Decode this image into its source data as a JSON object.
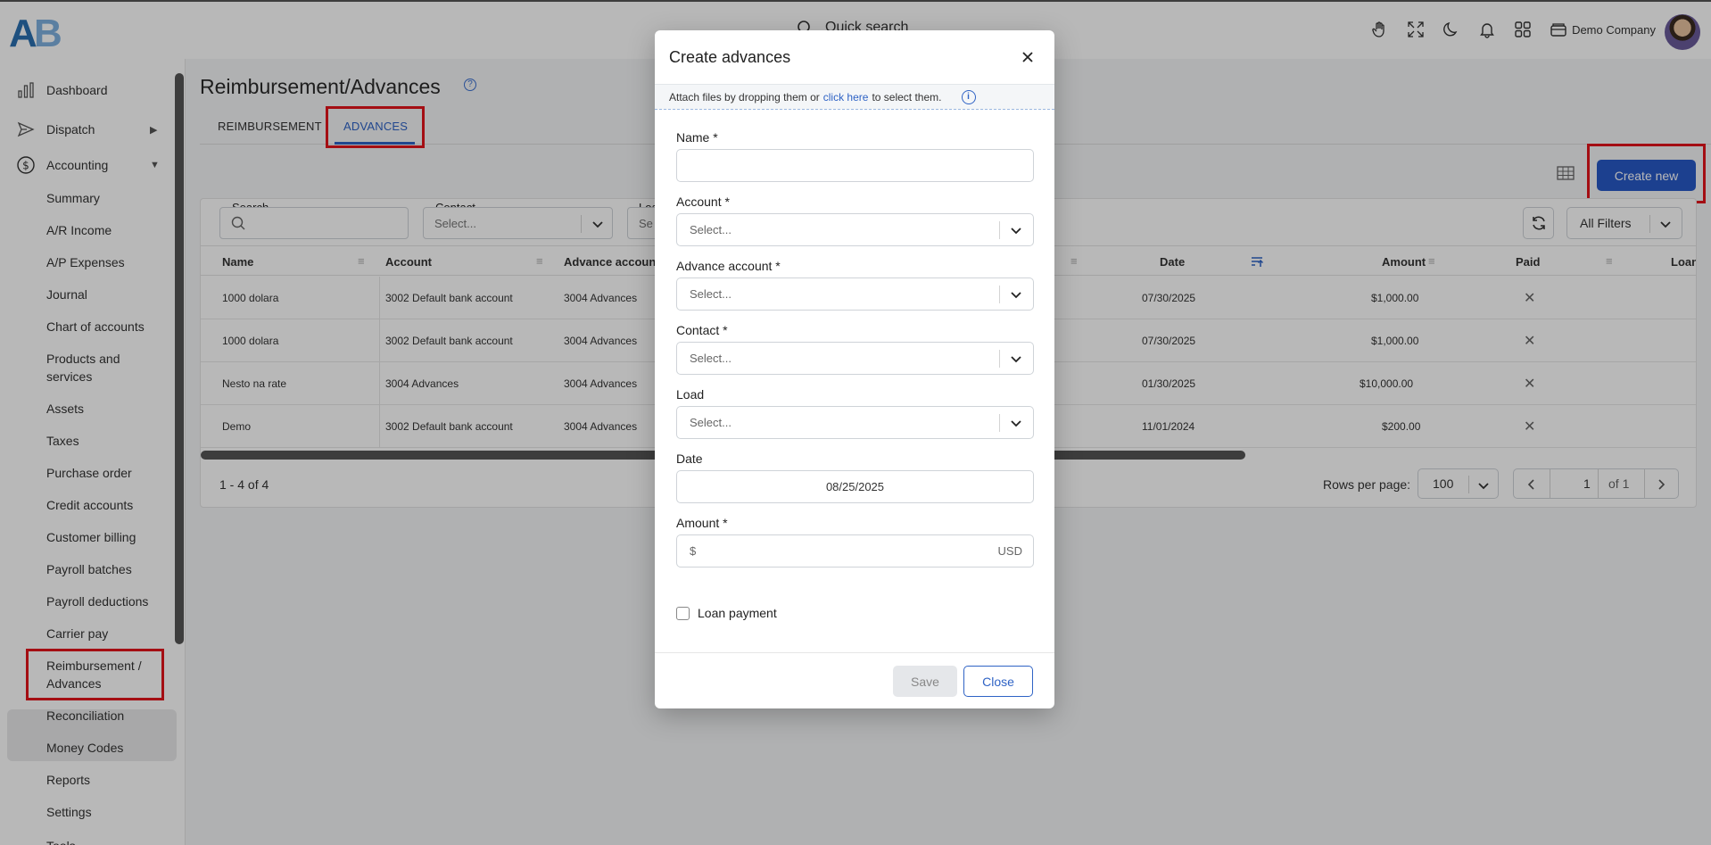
{
  "header": {
    "search_label": "Quick search",
    "company": "Demo Company",
    "icons": [
      "hand-icon",
      "fullscreen-icon",
      "moon-icon",
      "bell-icon",
      "apps-grid-icon",
      "wallet-icon"
    ]
  },
  "sidebar": {
    "top": [
      {
        "label": "Dashboard",
        "icon": "dashboard-chart-icon"
      },
      {
        "label": "Dispatch",
        "icon": "send-icon",
        "arrow": "▶"
      },
      {
        "label": "Accounting",
        "icon": "dollar-circle-icon",
        "arrow": "▼"
      }
    ],
    "sub": [
      "Summary",
      "A/R Income",
      "A/P Expenses",
      "Journal",
      "Chart of accounts",
      "Products and",
      "services",
      "Assets",
      "Taxes",
      "Purchase order",
      "Credit accounts",
      "Customer billing",
      "Payroll batches",
      "Payroll deductions",
      "Carrier pay",
      "Reimbursement /",
      "Advances",
      "Reconciliation",
      "Money Codes",
      "Reports",
      "Settings"
    ],
    "cut_off_label": "Tools"
  },
  "page": {
    "title": "Reimbursement/Advances",
    "tabs": [
      "REIMBURSEMENT",
      "ADVANCES"
    ],
    "create_button": "Create new"
  },
  "filters": {
    "search_label": "Search",
    "contact_label": "Contact",
    "contact_placeholder": "Select...",
    "load_label": "Loa",
    "load_placeholder": "Se",
    "all_filters": "All Filters"
  },
  "table": {
    "headers": [
      "Name",
      "Account",
      "Advance account",
      "Date",
      "Amount",
      "Paid",
      "Loan"
    ],
    "rows": [
      {
        "name": "1000 dolara",
        "account": "3002 Default bank account",
        "advance": "3004 Advances",
        "date": "07/30/2025",
        "amount": "$1,000.00"
      },
      {
        "name": "1000 dolara",
        "account": "3002 Default bank account",
        "advance": "3004 Advances",
        "date": "07/30/2025",
        "amount": "$1,000.00"
      },
      {
        "name": "Nesto na rate",
        "account": "3004 Advances",
        "advance": "3004 Advances",
        "date": "01/30/2025",
        "amount": "$10,000.00"
      },
      {
        "name": "Demo",
        "account": "3002 Default bank account",
        "advance": "3004 Advances",
        "date": "11/01/2024",
        "amount": "$200.00"
      }
    ]
  },
  "pagination": {
    "range": "1 - 4 of 4",
    "rows_per_page_label": "Rows per page:",
    "rows_per_page": "100",
    "page": "1",
    "of_pages": "of 1"
  },
  "modal": {
    "title": "Create advances",
    "attach_prefix": "Attach files by dropping them or",
    "attach_link": "click here",
    "attach_suffix": "to select them.",
    "fields": {
      "name_label": "Name *",
      "account_label": "Account *",
      "account_placeholder": "Select...",
      "advance_label": "Advance account *",
      "advance_placeholder": "Select...",
      "contact_label": "Contact *",
      "contact_placeholder": "Select...",
      "load_label": "Load",
      "load_placeholder": "Select...",
      "date_label": "Date",
      "date_value": "08/25/2025",
      "amount_label": "Amount *",
      "amount_prefix": "$",
      "amount_currency": "USD"
    },
    "loan_payment_label": "Loan payment",
    "save": "Save",
    "close": "Close"
  }
}
